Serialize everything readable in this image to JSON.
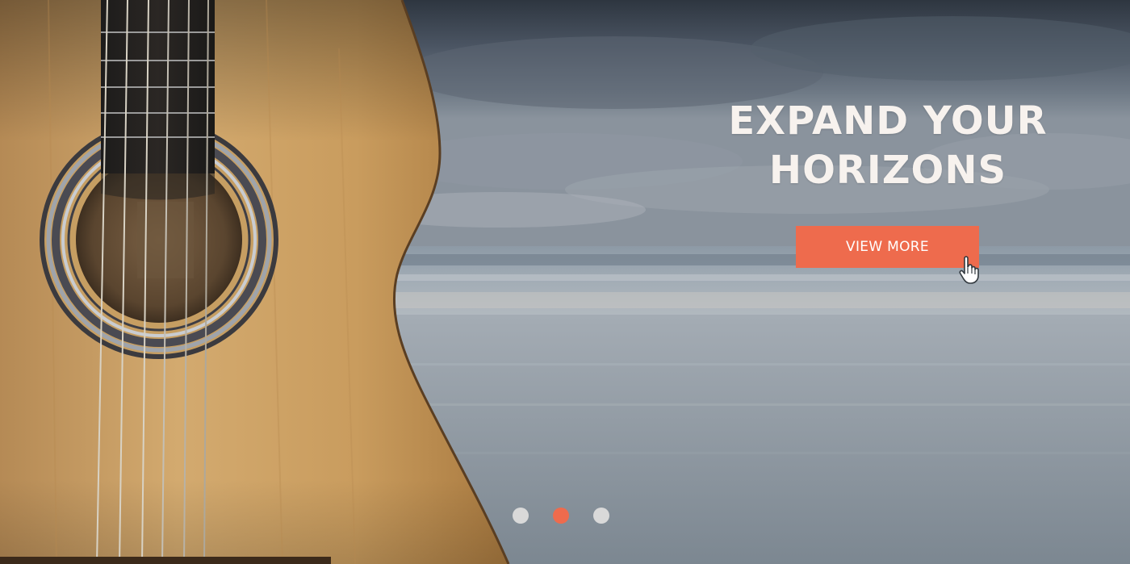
{
  "slide": {
    "title_line1": "EXPAND YOUR",
    "title_line2": "HORIZONS",
    "button_label": "VIEW MORE"
  },
  "pagination": {
    "total": 3,
    "active_index": 1
  },
  "colors": {
    "accent": "#ee6b4d",
    "heading": "#f7f2ee",
    "dot_inactive": "#d9d9d9",
    "dot_active": "#ee6b4d"
  },
  "icons": {
    "cursor": "hand-pointer-icon"
  }
}
